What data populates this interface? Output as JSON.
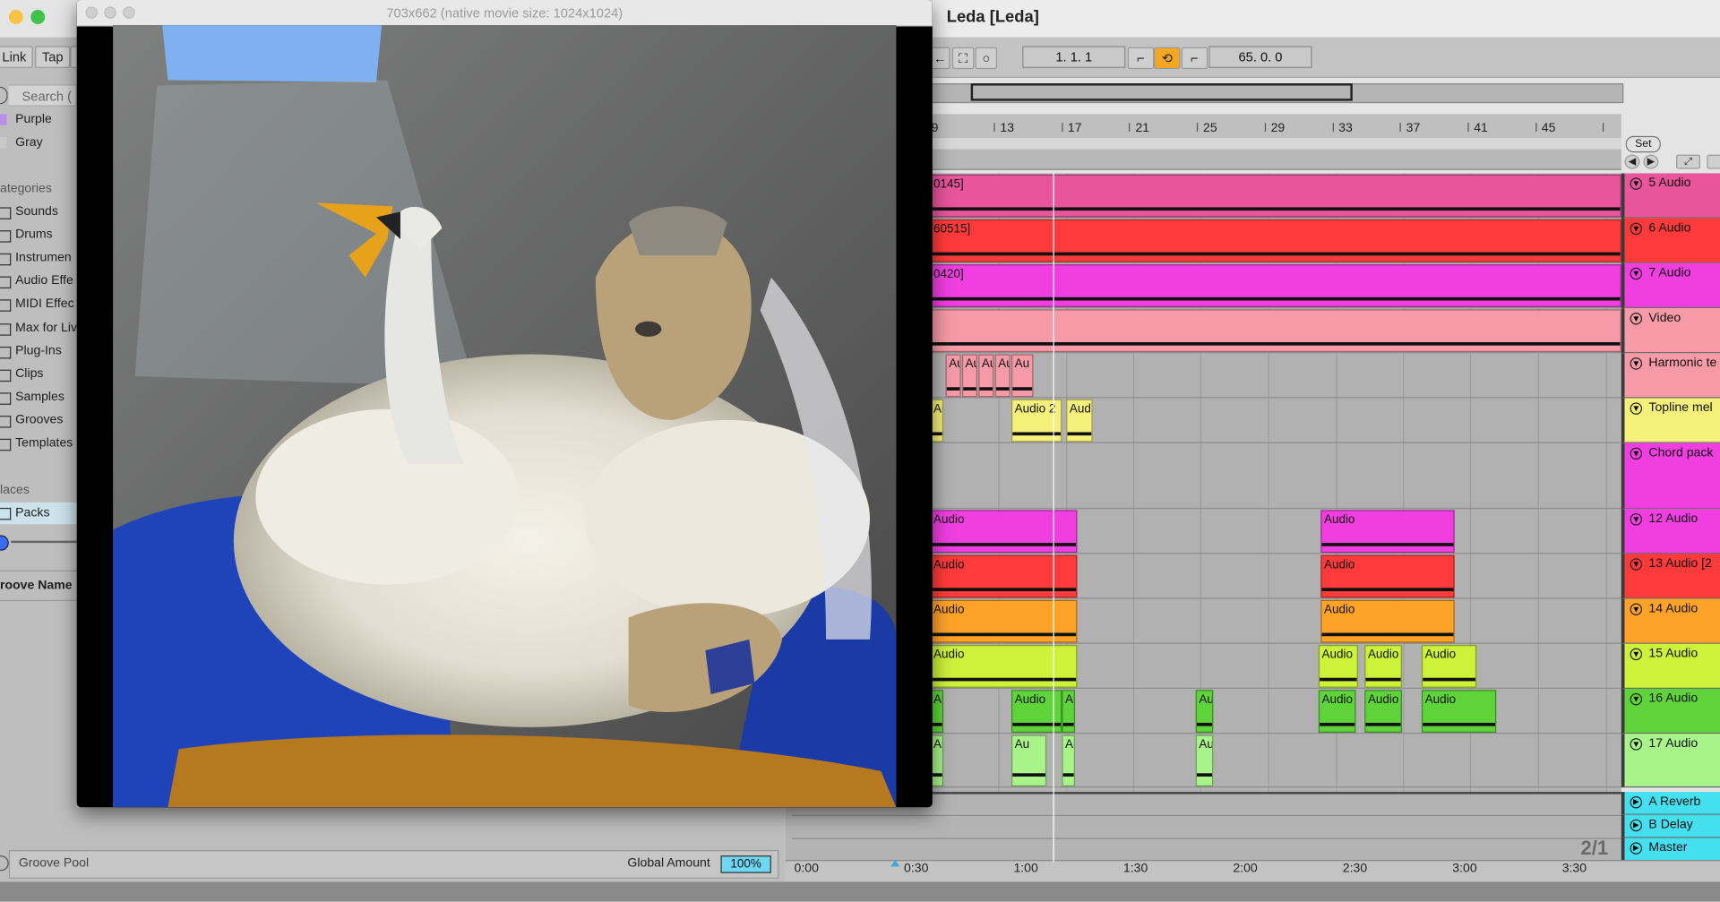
{
  "live_window": {
    "title": "Leda  [Leda]",
    "left_strip": {
      "link_label": "Link",
      "tap_label": "Tap"
    },
    "browser": {
      "search_placeholder": "Search (",
      "colors": [
        {
          "label": "Purple",
          "color": "#b98ee8"
        },
        {
          "label": "Gray",
          "color": "#c9c9c9"
        }
      ],
      "categories_header": "ategories",
      "categories": [
        "Sounds",
        "Drums",
        "Instrumen",
        "Audio Effe",
        "MIDI Effec",
        "Max for Liv",
        "Plug-Ins",
        "Clips",
        "Samples",
        "Grooves",
        "Templates"
      ],
      "places_header": "laces",
      "places": [
        "Packs"
      ],
      "groove_name_header": "roove Name",
      "groove_pool_label": "Groove Pool",
      "global_amount_label": "Global Amount",
      "global_amount_value": "100%"
    },
    "transport": {
      "position": "1.   1.   1",
      "loop_length": "65.   0.   0"
    },
    "ruler_bars": [
      "9",
      "13",
      "17",
      "21",
      "25",
      "29",
      "33",
      "37",
      "41",
      "45"
    ],
    "set_label": "Set",
    "tracks": [
      {
        "name": "5 Audio",
        "color": "#e8559b",
        "head_color": "#e8559b",
        "clip_text": "0145]"
      },
      {
        "name": "6 Audio",
        "color": "#ff3a3a",
        "head_color": "#ff3a3a",
        "clip_text": "60515]"
      },
      {
        "name": "7 Audio",
        "color": "#f03ee0",
        "head_color": "#f03ee0",
        "clip_text": "0420]"
      },
      {
        "name": "Video",
        "color": "#f59aa6",
        "head_color": "#f59aa6",
        "clip_text": ""
      },
      {
        "name": "Harmonic te",
        "color": "#f59aa6",
        "head_color": "#f59aa6",
        "clip_text": "Au"
      },
      {
        "name": "Topline mel",
        "color": "#f5f07a",
        "head_color": "#f5f07a",
        "clip_text": "Audio 2"
      },
      {
        "name": "Chord pack",
        "color": "#f03ee0",
        "head_color": "#f03ee0",
        "clip_text": ""
      },
      {
        "name": "12 Audio",
        "color": "#f03ee0",
        "head_color": "#f03ee0",
        "clip_text": "Audio"
      },
      {
        "name": "13 Audio [2",
        "color": "#ff3a3a",
        "head_color": "#ff3a3a",
        "clip_text": "Audio"
      },
      {
        "name": "14 Audio",
        "color": "#ffa228",
        "head_color": "#ffa228",
        "clip_text": "Audio"
      },
      {
        "name": "15 Audio",
        "color": "#ccf23a",
        "head_color": "#ccf23a",
        "clip_text": "Audio"
      },
      {
        "name": "16 Audio",
        "color": "#5fd43a",
        "head_color": "#5fd43a",
        "clip_text": "Audio"
      },
      {
        "name": "17 Audio",
        "color": "#a8f38a",
        "head_color": "#a8f38a",
        "clip_text": "Au"
      }
    ],
    "returns": [
      {
        "name": "A Reverb",
        "color": "#45e0f0"
      },
      {
        "name": "B Delay",
        "color": "#45e0f0"
      },
      {
        "name": "Master",
        "color": "#45e0f0"
      }
    ],
    "time_labels": [
      "0:00",
      "0:30",
      "1:00",
      "1:30",
      "2:00",
      "2:30",
      "3:00",
      "3:30"
    ],
    "fraction": "2/1"
  },
  "movie_window": {
    "title": "703x662 (native movie size: 1024x1024)"
  }
}
